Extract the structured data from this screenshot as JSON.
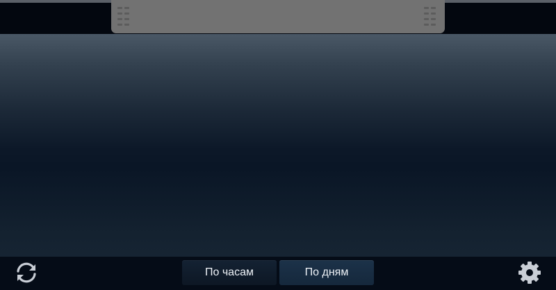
{
  "top_panel": {
    "handle_left_icon": "grip-dots-icon",
    "handle_right_icon": "grip-dots-icon"
  },
  "bottom_bar": {
    "refresh_icon": "refresh-icon",
    "settings_icon": "gear-icon",
    "view_toggle": {
      "hours_label": "По часам",
      "days_label": "По дням",
      "selected": "days"
    }
  },
  "colors": {
    "top_bar_bg": "#03070f",
    "handle_panel": "#727272",
    "gradient_top": "#4a5866",
    "gradient_bottom": "#0a1626",
    "icon_color": "#c9ced6",
    "text_color": "#eef2f7",
    "active_button": "#1c3249"
  }
}
